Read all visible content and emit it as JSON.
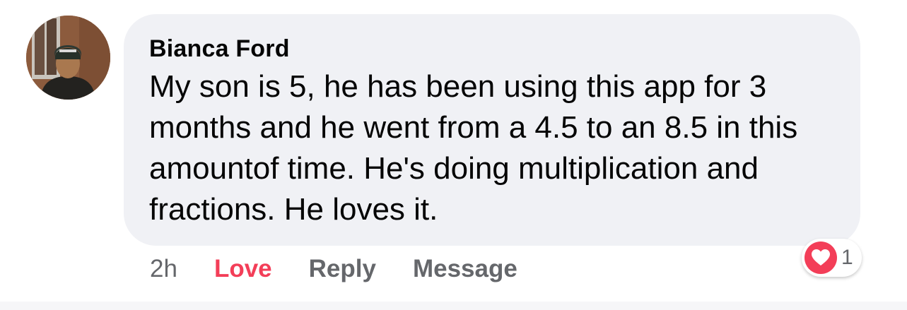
{
  "comment": {
    "author": "Bianca Ford",
    "text": "My son is 5, he has been using this app for 3 months and he went from a 4.5 to an 8.5 in this amountof time. He's doing multiplication and fractions. He loves it.",
    "timestamp": "2h",
    "actions": {
      "love_label": "Love",
      "reply_label": "Reply",
      "message_label": "Message"
    },
    "reaction": {
      "icon": "heart-icon",
      "count": "1"
    }
  },
  "colors": {
    "bubble": "#f0f1f5",
    "love": "#f33e58",
    "secondary_text": "#65676b",
    "primary_text": "#050505"
  }
}
